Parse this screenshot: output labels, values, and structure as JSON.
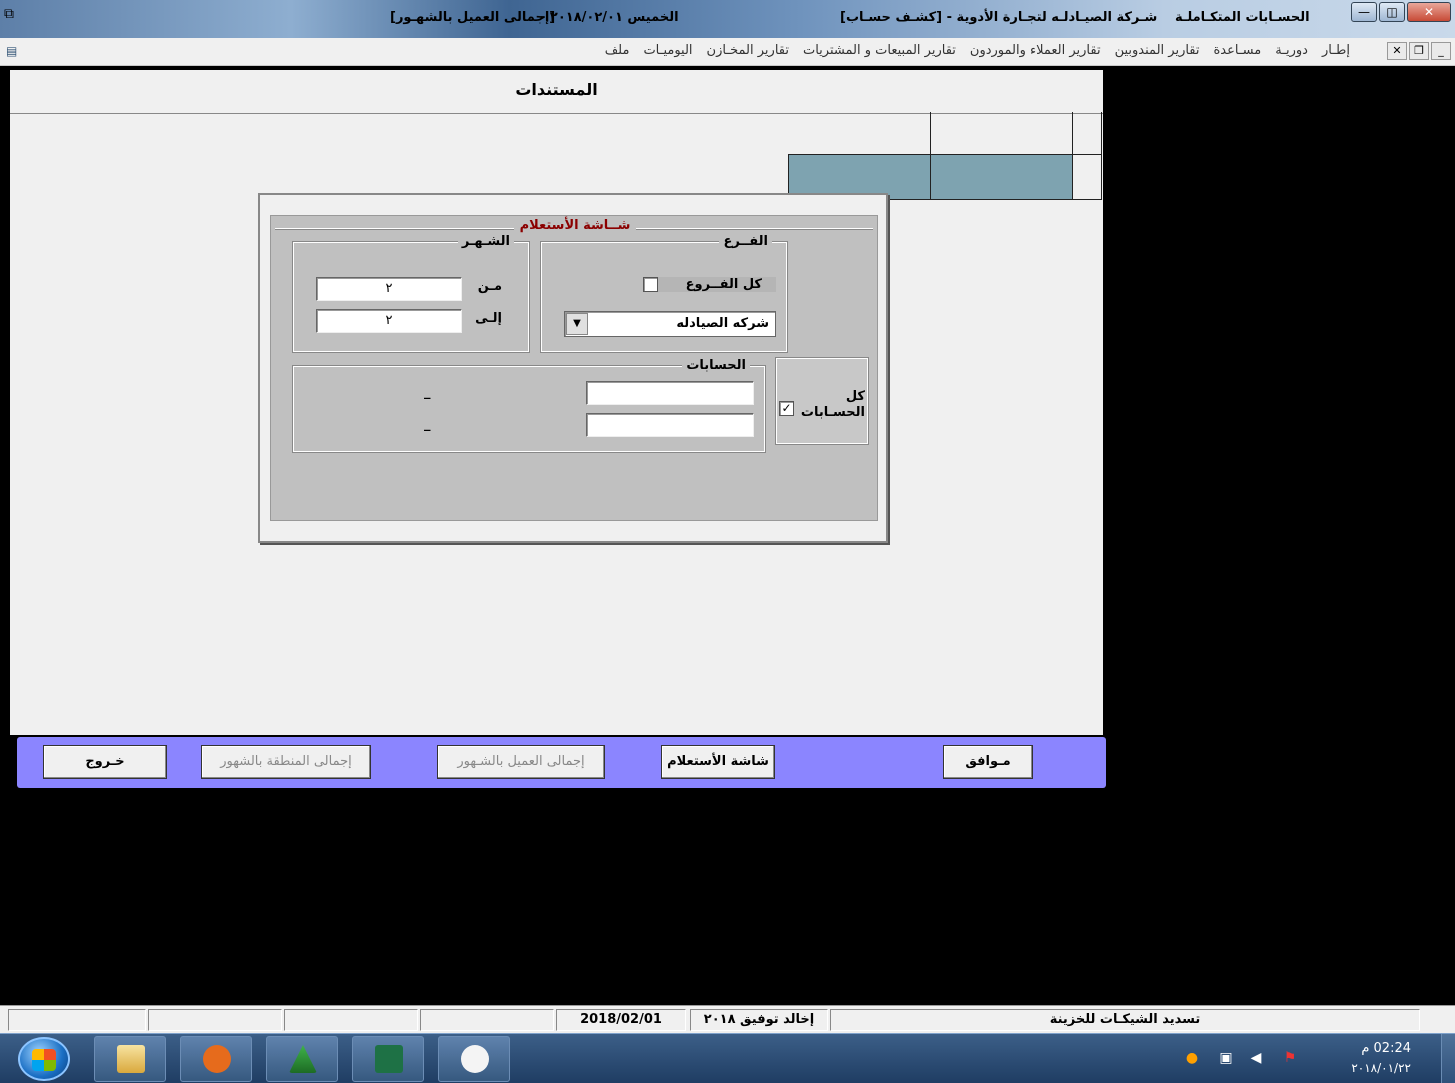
{
  "titlebar": {
    "app_name": "الحسـابات المتكـاملـة",
    "company": "شـركة الصيـادلـه لتجـارة الأدوية - [كشـف حسـاب]",
    "date": "الخميس   ٢٠١٨/٠٢/٠١ -",
    "window": "[إجمالى العميل بالشهـور]"
  },
  "menubar": {
    "items": [
      "ملف",
      "اليوميـات",
      "تقارير المخـازن",
      "تقارير المبيعات و المشتريات",
      "تقارير العملاء والموردون",
      "تقارير المندوبين",
      "مسـاعدة",
      "دوريـة",
      "إطـار"
    ]
  },
  "form": {
    "title": "المستندات"
  },
  "dialog": {
    "title": "شــاشة الأستعلام",
    "branch_group": "الفــرع",
    "all_branches_label": "كل الفــروع",
    "all_branches_checked": false,
    "branch_value": "شركه الصيادله",
    "month_group": "الشـهـر",
    "from_label": "مـن",
    "from_value": "٢",
    "to_label": "إلـى",
    "to_value": "٢",
    "accounts_group": "الحسابات",
    "all_accounts_label_1": "كل",
    "all_accounts_label_2": "الحسـابات",
    "all_accounts_checked": true,
    "account_from": "",
    "account_to": "",
    "dash_1": "_",
    "dash_2": "_"
  },
  "buttons": {
    "ok": "مـوافق",
    "query_screen": "شاشة الأستعلام",
    "client_by_month": "إجمالى العميل بالشـهور",
    "region_by_month": "إجمالى المنطقة بالشهور",
    "exit": "خـروج"
  },
  "statusbar": {
    "message": "تسديد الشيكـات للخزينة",
    "license": "إخالد توفيق ٢٠١٨",
    "date": "2018/02/01"
  },
  "taskbar": {
    "clock_time": "02:24 م",
    "clock_date": "٢٠١٨/٠١/٢٢"
  },
  "colors": {
    "button_bar": "#8b85ff",
    "grid_fill": "#7ea3b0",
    "dialog_title": "#8b0000"
  }
}
